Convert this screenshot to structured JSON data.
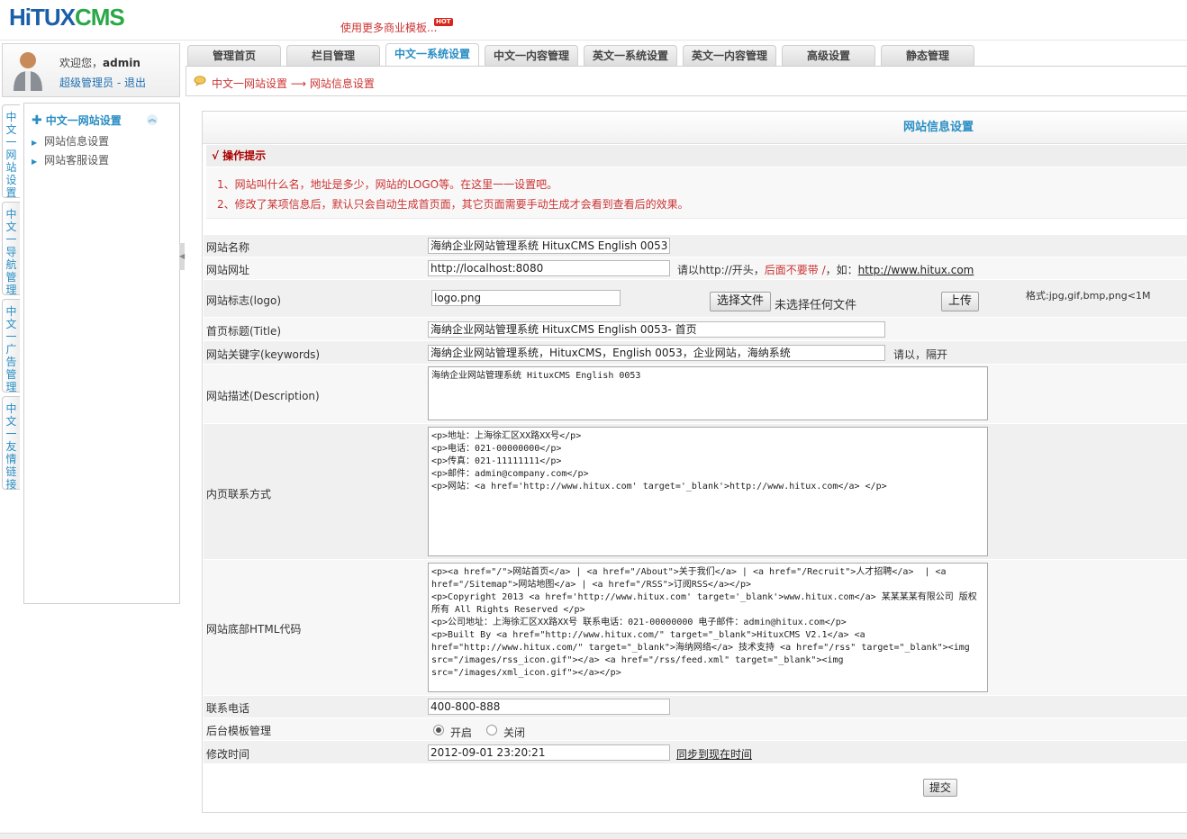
{
  "header": {
    "logo_part1": "HiTUX",
    "logo_part2": "CMS",
    "promo_text": "使用更多商业模板...",
    "hot_badge": "HOT"
  },
  "user": {
    "welcome": "欢迎您，",
    "name": "admin",
    "role_link": "超级管理员",
    "separator": "-",
    "logout_link": "退出"
  },
  "tabs": [
    {
      "label": "管理首页",
      "active": false
    },
    {
      "label": "栏目管理",
      "active": false
    },
    {
      "label": "中文一系统设置",
      "active": true
    },
    {
      "label": "中文一内容管理",
      "active": false
    },
    {
      "label": "英文一系统设置",
      "active": false
    },
    {
      "label": "英文一内容管理",
      "active": false
    },
    {
      "label": "高级设置",
      "active": false
    },
    {
      "label": "静态管理",
      "active": false
    }
  ],
  "breadcrumb": "中文一网站设置 ⟶ 网站信息设置",
  "side_tabs": [
    "中文一网站设置",
    "中文一导航管理",
    "中文一广告管理",
    "中文一友情链接"
  ],
  "sidebar": {
    "heading": "中文一网站设置",
    "items": [
      "网站信息设置",
      "网站客服设置"
    ]
  },
  "panel": {
    "title": "网站信息设置",
    "tips_heading": "√ 操作提示",
    "tips": [
      "1、网站叫什么名，地址是多少，网站的LOGO等。在这里一一设置吧。",
      "2、修改了某项信息后，默认只会自动生成首页面，其它页面需要手动生成才会看到查看后的效果。"
    ]
  },
  "form": {
    "site_name": {
      "label": "网站名称",
      "value": "海纳企业网站管理系统 HituxCMS English 0053"
    },
    "site_url": {
      "label": "网站网址",
      "value": "http://localhost:8080",
      "hint_prefix": "请以http://开头，",
      "hint_warn": "后面不要带 /",
      "hint_mid": "，如：",
      "hint_link": "http://www.hitux.com"
    },
    "logo": {
      "label": "网站标志(logo)",
      "value": "logo.png",
      "choose_button": "选择文件",
      "no_file_text": "未选择任何文件",
      "upload_button": "上传",
      "format_hint": "格式:jpg,gif,bmp,png<1M"
    },
    "home_title": {
      "label": "首页标题(Title)",
      "value": "海纳企业网站管理系统 HituxCMS English 0053- 首页"
    },
    "keywords": {
      "label": "网站关键字(keywords)",
      "value": "海纳企业网站管理系统，HituxCMS，English 0053，企业网站，海纳系统",
      "hint": "请以，隔开"
    },
    "description": {
      "label": "网站描述(Description)",
      "value": "海纳企业网站管理系统 HituxCMS English 0053"
    },
    "contact": {
      "label": "内页联系方式",
      "value": "<p>地址：上海徐汇区XX路XX号</p>\n<p>电话：021-00000000</p>\n<p>传真：021-11111111</p>\n<p>邮件：admin@company.com</p>\n<p>网站：<a href='http://www.hitux.com' target='_blank'>http://www.hitux.com</a> </p>"
    },
    "footer_html": {
      "label": "网站底部HTML代码",
      "value": "<p><a href=\"/\">网站首页</a> | <a href=\"/About\">关于我们</a> | <a href=\"/Recruit\">人才招聘</a>  | <a href=\"/Sitemap\">网站地图</a> | <a href=\"/RSS\">订阅RSS</a></p>\n<p>Copyright 2013 <a href='http://www.hitux.com' target='_blank'>www.hitux.com</a> 某某某某有限公司 版权所有 All Rights Reserved </p>\n<p>公司地址：上海徐汇区XX路XX号 联系电话：021-00000000 电子邮件：admin@hitux.com</p>\n<p>Built By <a href=\"http://www.hitux.com/\" target=\"_blank\">HituxCMS V2.1</a> <a href=\"http://www.hitux.com/\" target=\"_blank\">海纳网络</a> 技术支持 <a href=\"/rss\" target=\"_blank\"><img src=\"/images/rss_icon.gif\"></a> <a href=\"/rss/feed.xml\" target=\"_blank\"><img src=\"/images/xml_icon.gif\"></a></p>"
    },
    "phone": {
      "label": "联系电话",
      "value": "400-800-888"
    },
    "template_mgmt": {
      "label": "后台模板管理",
      "option_on": "开启",
      "option_off": "关闭",
      "selected": "开启"
    },
    "modified_time": {
      "label": "修改时间",
      "value": "2012-09-01 23:20:21",
      "sync_link": "同步到现在时间"
    },
    "submit_button": "提交"
  }
}
